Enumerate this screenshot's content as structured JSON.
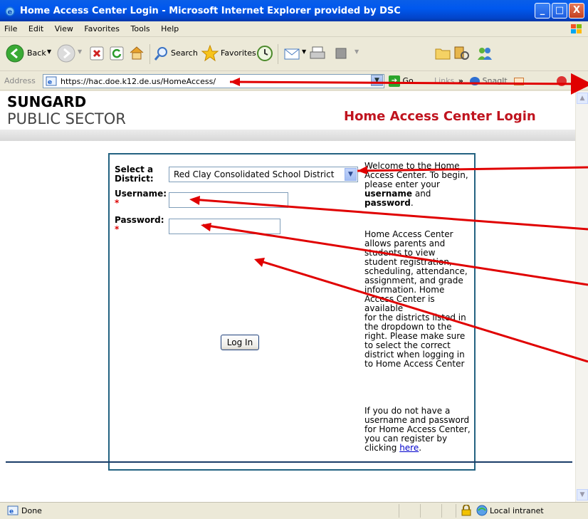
{
  "window": {
    "title": "Home Access Center Login - Microsoft Internet Explorer provided by DSC",
    "min_label": "_",
    "max_label": "□",
    "close_label": "X"
  },
  "menu": {
    "items": [
      "File",
      "Edit",
      "View",
      "Favorites",
      "Tools",
      "Help"
    ]
  },
  "toolbar": {
    "back_label": "Back",
    "search_label": "Search",
    "favorites_label": "Favorites"
  },
  "address_bar": {
    "label": "Address",
    "url": "https://hac.doe.k12.de.us/HomeAccess/",
    "go_label": "Go",
    "links_label": "Links",
    "snagit_label": "SnagIt"
  },
  "page": {
    "logo_line1": "SUNGARD",
    "logo_line2": "PUBLIC SECTOR",
    "title": "Home Access Center Login",
    "form": {
      "district_label_1": "Select a",
      "district_label_2": "District:",
      "district_value": "Red Clay Consolidated School District",
      "username_label": "Username:",
      "username_value": "",
      "password_label": "Password:",
      "password_value": "",
      "required_mark": "*",
      "login_button": "Log In"
    },
    "info": {
      "p1_lines": [
        "Welcome to the Home",
        "Access Center. To begin,",
        "please enter your"
      ],
      "p1_bold1": "username",
      "p1_and": " and",
      "p1_bold2": "password",
      "p1_end": ".",
      "p2_lines": [
        "Home Access Center",
        "allows parents and",
        "students to view",
        "student registration,",
        "scheduling, attendance,",
        "assignment, and grade",
        "information. Home",
        "Access Center is available",
        "for the districts listed in",
        "the dropdown to the",
        "right. Please make sure",
        "to select the correct",
        "district when logging in",
        "to Home Access Center"
      ],
      "p3_lines": [
        "If you do not have a",
        "username and password",
        "for Home Access Center,",
        "you can register by"
      ],
      "p3_click": "clicking ",
      "p3_link": "here",
      "p3_end": "."
    }
  },
  "status_bar": {
    "status": "Done",
    "zone": "Local intranet"
  },
  "colors": {
    "title_red": "#c0141f",
    "box_border": "#236281",
    "annotation_arrow": "#e00000"
  }
}
